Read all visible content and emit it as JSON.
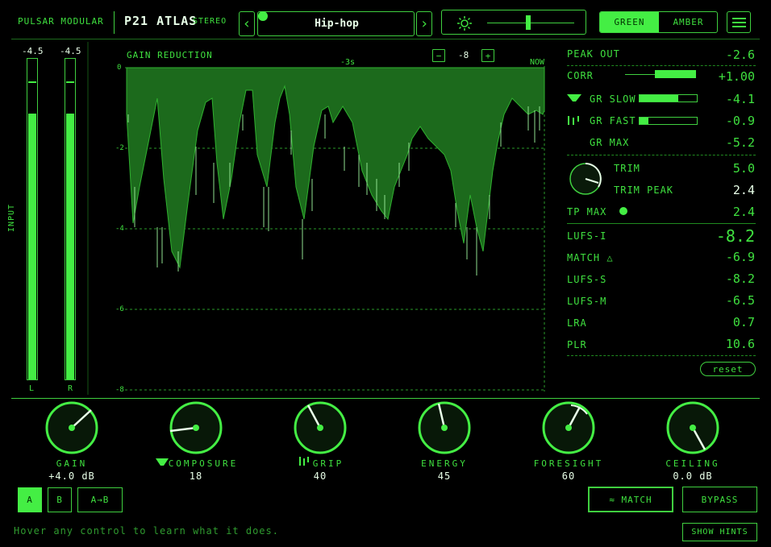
{
  "header": {
    "brand": "PULSAR MODULAR",
    "product": "P21 ATLAS",
    "mode": "STEREO",
    "preset": "Hip-hop",
    "theme_options": [
      "GREEN",
      "AMBER"
    ],
    "theme_selected": "GREEN",
    "colors": {
      "accent": "#3fe03f",
      "active_bg": "#44ee44",
      "bg": "#000000",
      "fill": "#1c6a1c"
    }
  },
  "meters": {
    "left_peak": "-4.5",
    "right_peak": "-4.5",
    "left_label": "L",
    "right_label": "R",
    "input_label": "INPUT",
    "left_level": 0.83,
    "right_level": 0.83
  },
  "graph": {
    "title": "GAIN REDUCTION",
    "time_marker": "-3s",
    "now_label": "NOW",
    "zoom_minus": "−",
    "zoom_value": "-8",
    "zoom_plus": "+",
    "y_ticks": [
      "0",
      "-2",
      "-4",
      "-6",
      "-8"
    ]
  },
  "readouts": {
    "peak_out_label": "PEAK OUT",
    "peak_out": "-2.6",
    "corr_label": "CORR",
    "corr": "+1.00",
    "corr_level": 0.85,
    "gr_slow_label": "GR SLOW",
    "gr_slow": "-4.1",
    "gr_slow_level": 0.68,
    "gr_fast_label": "GR FAST",
    "gr_fast": "-0.9",
    "gr_fast_level": 0.15,
    "gr_max_label": "GR MAX",
    "gr_max": "-5.2",
    "trim_label": "TRIM",
    "trim": "5.0",
    "trim_peak_label": "TRIM PEAK",
    "trim_peak": "2.4",
    "tp_max_label": "TP MAX",
    "tp_max": "2.4",
    "lufs_i_label": "LUFS-I",
    "lufs_i": "-8.2",
    "match_label": "MATCH △",
    "match": "-6.9",
    "lufs_s_label": "LUFS-S",
    "lufs_s": "-8.2",
    "lufs_m_label": "LUFS-M",
    "lufs_m": "-6.5",
    "lra_label": "LRA",
    "lra": "0.7",
    "plr_label": "PLR",
    "plr": "10.6",
    "reset_label": "reset"
  },
  "knobs": [
    {
      "name": "GAIN",
      "value": "+4.0 dB"
    },
    {
      "name": "COMPOSURE",
      "value": "18"
    },
    {
      "name": "GRIP",
      "value": "40"
    },
    {
      "name": "ENERGY",
      "value": "45"
    },
    {
      "name": "FORESIGHT",
      "value": "60"
    },
    {
      "name": "CEILING",
      "value": "0.0 dB"
    }
  ],
  "footer": {
    "slot_a": "A",
    "slot_b": "B",
    "copy_ab": "A→B",
    "match_button": "≈ MATCH",
    "bypass_button": "BYPASS",
    "hint": "Hover any control to learn what it does.",
    "show_hints": "SHOW HINTS"
  }
}
